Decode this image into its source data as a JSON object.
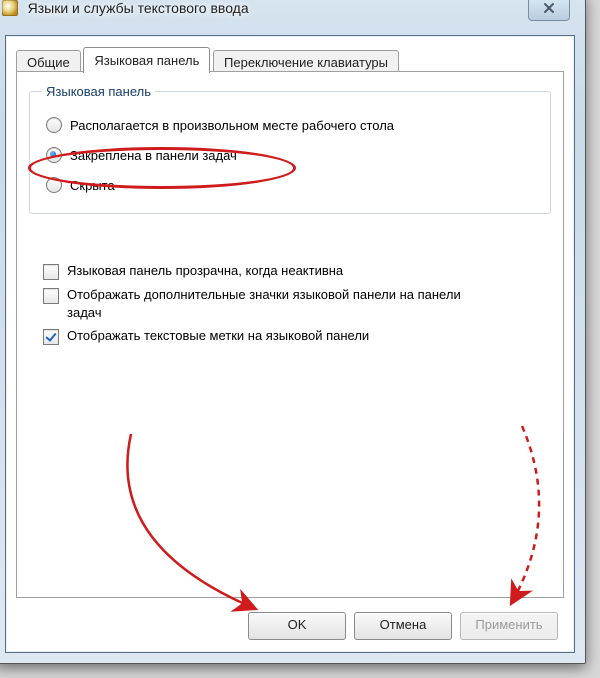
{
  "window": {
    "title": "Языки и службы текстового ввода"
  },
  "tabs": [
    {
      "label": "Общие"
    },
    {
      "label": "Языковая панель"
    },
    {
      "label": "Переключение клавиатуры"
    }
  ],
  "group": {
    "legend": "Языковая панель",
    "radios": [
      {
        "label": "Располагается в произвольном месте рабочего стола",
        "selected": false
      },
      {
        "label": "Закреплена в панели задач",
        "selected": true
      },
      {
        "label": "Скрыта",
        "selected": false
      }
    ]
  },
  "checks": [
    {
      "label": "Языковая панель прозрачна, когда неактивна",
      "checked": false
    },
    {
      "label": "Отображать дополнительные значки языковой панели на панели задач",
      "checked": false
    },
    {
      "label": "Отображать текстовые метки на языковой панели",
      "checked": true
    }
  ],
  "buttons": {
    "ok": "OK",
    "cancel": "Отмена",
    "apply": "Применить"
  }
}
